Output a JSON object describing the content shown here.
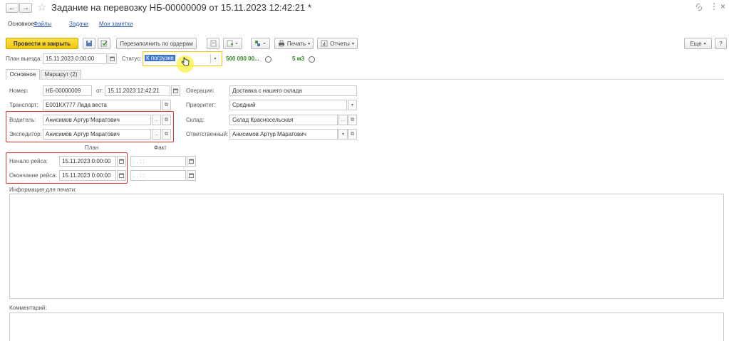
{
  "window": {
    "title": "Задание на перевозку НБ-00000009 от 15.11.2023 12:42:21 *",
    "back": "←",
    "forward": "→",
    "star": "☆",
    "more": "⋮",
    "close": "×"
  },
  "nav": {
    "items": [
      "Основное",
      "Файлы",
      "Задачи",
      "Мои заметки"
    ]
  },
  "toolbar": {
    "post_close": "Провести и закрыть",
    "refill": "Перезаполнить по ордерам",
    "print": "Печать",
    "reports": "Отчеты",
    "more": "Еще",
    "help": "?"
  },
  "header": {
    "plan_label": "План выезда:",
    "plan_value": "15.11.2023  0:00:00",
    "status_label": "Статус:",
    "status_value": "К погрузке",
    "weight": "500 000 00...",
    "volume": "5 м3"
  },
  "tabs": [
    "Основное",
    "Маршрут (2)"
  ],
  "form": {
    "number_label": "Номер:",
    "number_value": "НБ-00000009",
    "from_label": "от:",
    "from_value": "15.11.2023 12:42:21",
    "transport_label": "Транспорт:",
    "transport_value": "Е001КХ777 Лада веста",
    "driver_label": "Водитель:",
    "driver_value": "Анисимов Артур Маратович",
    "forwarder_label": "Экспедитор:",
    "forwarder_value": "Анисимов Артур Маратович",
    "operation_label": "Операция:",
    "operation_value": "Доставка с нашего склада",
    "priority_label": "Приоритет:",
    "priority_value": "Средний",
    "warehouse_label": "Склад:",
    "warehouse_value": "Склад Красносельская",
    "responsible_label": "Ответственный:",
    "responsible_value": "Анисимов Артур Маратович",
    "plan_col": "План",
    "fact_col": "Факт",
    "start_label": "Начало рейса:",
    "start_plan": "15.11.2023  0:00:00",
    "start_fact": ". .      : :",
    "end_label": "Окончание рейса:",
    "end_plan": "15.11.2023  0:00:00",
    "end_fact": ". .      : :",
    "print_info_label": "Информация для печати:",
    "comment_label": "Комментарий:"
  },
  "colors": {
    "accent_yellow": "#f5d21b",
    "red_outline": "#d9302c",
    "green_text": "#2f8a1e",
    "link": "#2f5ea8"
  }
}
